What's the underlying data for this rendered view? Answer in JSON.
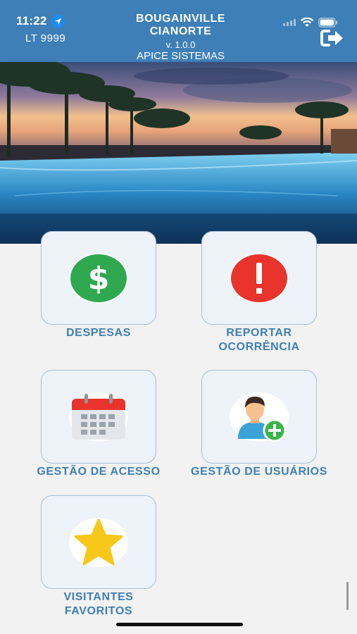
{
  "status_bar": {
    "time": "11:22"
  },
  "header": {
    "unit": "LT 9999",
    "title_line1": "BOUGAINVILLE",
    "title_line2": "CIANORTE",
    "version": "v. 1.0.0",
    "company": "APICE SISTEMAS"
  },
  "menu": {
    "despesas": "DESPESAS",
    "reportar_line1": "REPORTAR",
    "reportar_line2": "OCORRÊNCIA",
    "gestao_acesso": "GESTÃO DE ACESSO",
    "gestao_usuarios": "GESTÃO DE USUÁRIOS",
    "visitantes_line1": "VISITANTES",
    "visitantes_line2": "FAVORITOS"
  },
  "colors": {
    "header_bg": "#3d7fb6",
    "label": "#3d7fb6",
    "dollar_green": "#2fa84f",
    "alert_red": "#e8342d",
    "star_yellow": "#f7c71a"
  },
  "icons": {
    "despesas": "dollar-icon",
    "reportar": "exclamation-icon",
    "gestao_acesso": "calendar-icon",
    "gestao_usuarios": "user-add-icon",
    "visitantes": "star-icon",
    "logout": "logout-icon"
  }
}
